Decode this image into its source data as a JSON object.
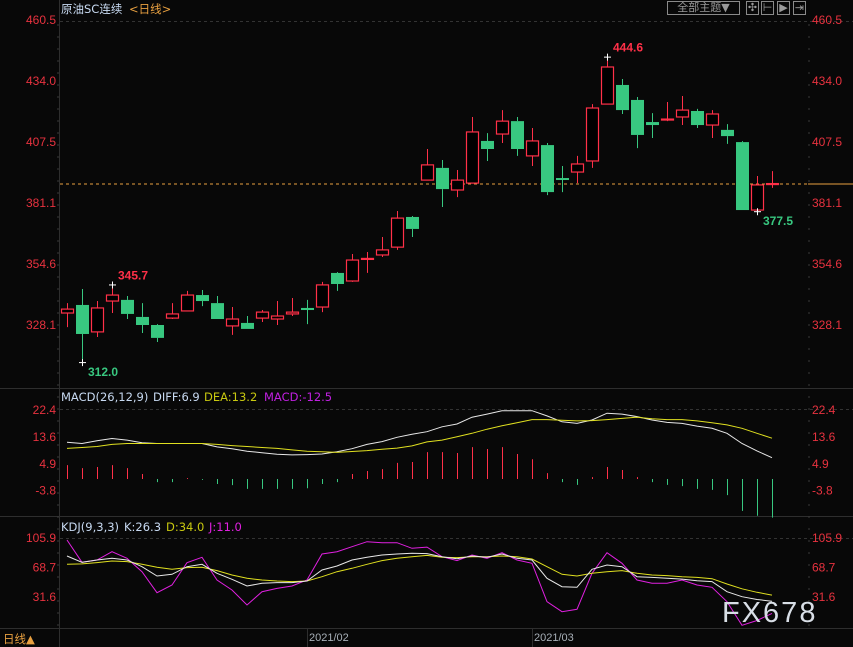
{
  "header": {
    "title": "原油SC连续",
    "period": "<日线>",
    "theme_button": "全部主题▼",
    "tool_icons": [
      "crosshair-icon",
      "zoom-in-range-icon",
      "play-forward-icon",
      "move-right-icon"
    ]
  },
  "footer": {
    "period_toggle": "日线▲",
    "watermark": "FX678"
  },
  "colors": {
    "up": "#ff3048",
    "down": "#38c880",
    "axis_text": "#e8323f",
    "diff": "#e8e8e8",
    "dea": "#e0e020",
    "macd_label": "#c020e0",
    "k": "#e8e8e8",
    "d": "#e0e020",
    "j": "#e020e0",
    "last_price_line": "#e8a040"
  },
  "chart_data": [
    {
      "type": "candlestick",
      "title": "原油SC连续",
      "yticks": [
        460.5,
        434.0,
        407.5,
        381.1,
        354.6,
        328.1
      ],
      "ylim": [
        312.0,
        460.5
      ],
      "x_ticks": [
        {
          "label": "2021/02",
          "index": 16
        },
        {
          "label": "2021/03",
          "index": 31
        }
      ],
      "last_price": 389.5,
      "annotations": [
        {
          "label": "345.7",
          "index": 3,
          "type": "high"
        },
        {
          "label": "312.0",
          "index": 1,
          "type": "low"
        },
        {
          "label": "444.6",
          "index": 36,
          "type": "high"
        },
        {
          "label": "377.5",
          "index": 46,
          "type": "low"
        }
      ],
      "ohlc": [
        [
          333.3,
          337.6,
          327.2,
          335.0
        ],
        [
          336.8,
          343.7,
          312.0,
          324.2
        ],
        [
          325.1,
          338.5,
          322.9,
          335.5
        ],
        [
          338.5,
          345.7,
          333.3,
          341.1
        ],
        [
          339.0,
          340.7,
          330.7,
          332.9
        ],
        [
          331.6,
          337.6,
          324.6,
          328.1
        ],
        [
          328.1,
          328.5,
          320.7,
          322.5
        ],
        [
          331.1,
          337.6,
          330.7,
          332.9
        ],
        [
          334.2,
          342.9,
          334.2,
          341.1
        ],
        [
          341.1,
          343.3,
          336.3,
          338.5
        ],
        [
          337.6,
          340.7,
          330.7,
          330.7
        ],
        [
          327.7,
          335.9,
          323.8,
          330.7
        ],
        [
          329.0,
          332.0,
          326.4,
          326.4
        ],
        [
          331.1,
          334.6,
          329.4,
          333.7
        ],
        [
          330.7,
          338.5,
          328.1,
          332.0
        ],
        [
          332.9,
          339.8,
          332.0,
          333.7
        ],
        [
          335.5,
          339.0,
          328.5,
          334.6
        ],
        [
          335.9,
          346.8,
          333.7,
          345.5
        ],
        [
          350.7,
          351.1,
          342.9,
          345.9
        ],
        [
          347.2,
          358.9,
          346.8,
          356.3
        ],
        [
          356.8,
          359.8,
          350.7,
          357.0
        ],
        [
          358.5,
          366.3,
          357.6,
          360.7
        ],
        [
          361.9,
          377.6,
          360.7,
          374.5
        ],
        [
          375.0,
          375.4,
          366.3,
          369.8
        ],
        [
          391.0,
          404.5,
          391.0,
          397.6
        ],
        [
          396.3,
          399.7,
          379.3,
          387.1
        ],
        [
          386.7,
          395.4,
          383.6,
          391.0
        ],
        [
          389.7,
          418.4,
          389.7,
          411.9
        ],
        [
          408.0,
          411.4,
          399.3,
          404.5
        ],
        [
          411.0,
          421.4,
          407.1,
          416.6
        ],
        [
          416.6,
          418.4,
          401.5,
          404.5
        ],
        [
          401.5,
          413.6,
          397.1,
          408.0
        ],
        [
          406.2,
          407.1,
          384.5,
          385.8
        ],
        [
          391.9,
          397.1,
          385.8,
          391.7
        ],
        [
          394.5,
          401.5,
          389.7,
          398.0
        ],
        [
          399.3,
          424.0,
          396.3,
          422.3
        ],
        [
          424.0,
          444.6,
          424.0,
          440.1
        ],
        [
          432.3,
          434.9,
          419.7,
          421.4
        ],
        [
          425.8,
          427.1,
          404.9,
          410.6
        ],
        [
          416.2,
          420.1,
          409.3,
          414.9
        ],
        [
          417.3,
          424.9,
          416.6,
          417.5
        ],
        [
          418.4,
          427.5,
          414.9,
          421.4
        ],
        [
          421.0,
          421.9,
          413.6,
          414.9
        ],
        [
          414.9,
          421.4,
          409.3,
          419.7
        ],
        [
          412.8,
          415.3,
          406.7,
          410.1
        ],
        [
          407.5,
          407.9,
          378.0,
          378.0
        ],
        [
          378.0,
          392.8,
          377.5,
          388.9
        ],
        [
          389.3,
          394.9,
          387.6,
          389.5
        ]
      ]
    },
    {
      "type": "line+bar",
      "title": "MACD(26,12,9)",
      "legend": {
        "diff": "DIFF:6.9",
        "dea": "DEA:13.2",
        "macd": "MACD:-12.5"
      },
      "yticks": [
        22.4,
        13.6,
        4.9,
        -3.8
      ],
      "series": [
        {
          "name": "DIFF",
          "values": [
            11.9,
            11.5,
            12.4,
            13.1,
            12.6,
            11.7,
            11.5,
            11.5,
            11.5,
            11.5,
            10.4,
            9.8,
            9.0,
            8.5,
            8.0,
            7.8,
            7.9,
            8.1,
            8.8,
            9.8,
            11.2,
            12.1,
            13.5,
            14.5,
            15.3,
            16.9,
            17.8,
            20.0,
            21.0,
            22.1,
            22.1,
            22.1,
            20.4,
            18.5,
            18.0,
            19.1,
            21.3,
            21.0,
            20.2,
            19.1,
            18.3,
            18.0,
            17.1,
            16.4,
            14.8,
            11.5,
            9.1,
            6.9
          ]
        },
        {
          "name": "DEA",
          "values": [
            9.9,
            10.2,
            10.5,
            11.2,
            11.5,
            11.5,
            11.5,
            11.5,
            11.5,
            11.5,
            11.2,
            10.8,
            10.5,
            10.2,
            9.9,
            9.4,
            9.0,
            8.8,
            8.6,
            8.9,
            9.2,
            9.6,
            10.0,
            10.7,
            12.0,
            12.6,
            13.7,
            14.8,
            16.1,
            17.2,
            18.2,
            19.2,
            19.2,
            19.0,
            18.8,
            18.9,
            19.2,
            19.6,
            20.0,
            19.5,
            19.2,
            19.2,
            18.8,
            18.2,
            17.5,
            16.4,
            14.8,
            13.2
          ]
        },
        {
          "name": "MACD",
          "values": [
            4.5,
            3.5,
            3.9,
            4.5,
            3.5,
            1.6,
            -1.0,
            -1.0,
            0.3,
            -0.3,
            -1.6,
            -2.0,
            -3.2,
            -3.2,
            -3.2,
            -3.2,
            -3.0,
            -1.6,
            -1.0,
            1.6,
            2.6,
            3.2,
            5.2,
            5.5,
            8.7,
            8.7,
            8.4,
            10.3,
            9.7,
            10.3,
            8.1,
            6.4,
            1.9,
            -1.0,
            -1.9,
            0.6,
            3.9,
            2.9,
            0.6,
            -1.0,
            -1.9,
            -2.3,
            -3.2,
            -3.5,
            -5.2,
            -10.3,
            -11.9,
            -12.5
          ]
        }
      ]
    },
    {
      "type": "line",
      "title": "KDJ(9,3,3)",
      "legend": {
        "k": "K:26.3",
        "d": "D:34.0",
        "j": "J:11.0"
      },
      "yticks": [
        105.9,
        68.7,
        31.6
      ],
      "series": [
        {
          "name": "K",
          "values": [
            83.2,
            75.3,
            78.2,
            80.3,
            78.2,
            69.8,
            58.1,
            60.2,
            69.8,
            72.8,
            61.5,
            53.9,
            45.5,
            48.9,
            49.7,
            49.7,
            51.8,
            65.6,
            70.6,
            78.2,
            81.6,
            84.5,
            85.8,
            86.7,
            86.2,
            82.4,
            79.9,
            83.2,
            81.6,
            85.8,
            80.3,
            78.2,
            55.1,
            44.6,
            43.8,
            66.5,
            71.9,
            69.8,
            57.2,
            56.3,
            55.1,
            54.2,
            52.0,
            51.0,
            38.3,
            32.0,
            28.5,
            26.3
          ]
        },
        {
          "name": "D",
          "values": [
            72.8,
            73.3,
            74.9,
            77.0,
            76.2,
            72.8,
            69.0,
            66.5,
            68.6,
            69.0,
            64.8,
            59.3,
            55.1,
            53.0,
            51.8,
            51.0,
            51.8,
            57.2,
            63.5,
            67.7,
            72.8,
            77.4,
            80.3,
            82.4,
            84.0,
            81.6,
            81.2,
            82.4,
            82.4,
            83.2,
            82.4,
            79.5,
            69.8,
            60.2,
            58.1,
            61.5,
            63.5,
            64.8,
            61.5,
            59.3,
            58.5,
            57.2,
            56.3,
            54.7,
            48.0,
            42.0,
            37.5,
            34.0
          ]
        },
        {
          "name": "J",
          "values": [
            103.4,
            75.3,
            78.2,
            88.7,
            80.3,
            63.5,
            37.0,
            46.7,
            74.8,
            81.6,
            53.0,
            40.4,
            21.5,
            38.3,
            42.5,
            45.5,
            53.0,
            85.8,
            88.7,
            95.0,
            101.3,
            100.0,
            100.0,
            92.9,
            94.5,
            82.4,
            77.4,
            84.5,
            80.3,
            87.4,
            78.2,
            74.0,
            25.7,
            13.1,
            16.1,
            61.5,
            87.4,
            74.0,
            53.0,
            48.9,
            48.9,
            53.0,
            46.7,
            43.8,
            25.7,
            -4.0,
            2.0,
            11.0
          ]
        }
      ]
    }
  ]
}
